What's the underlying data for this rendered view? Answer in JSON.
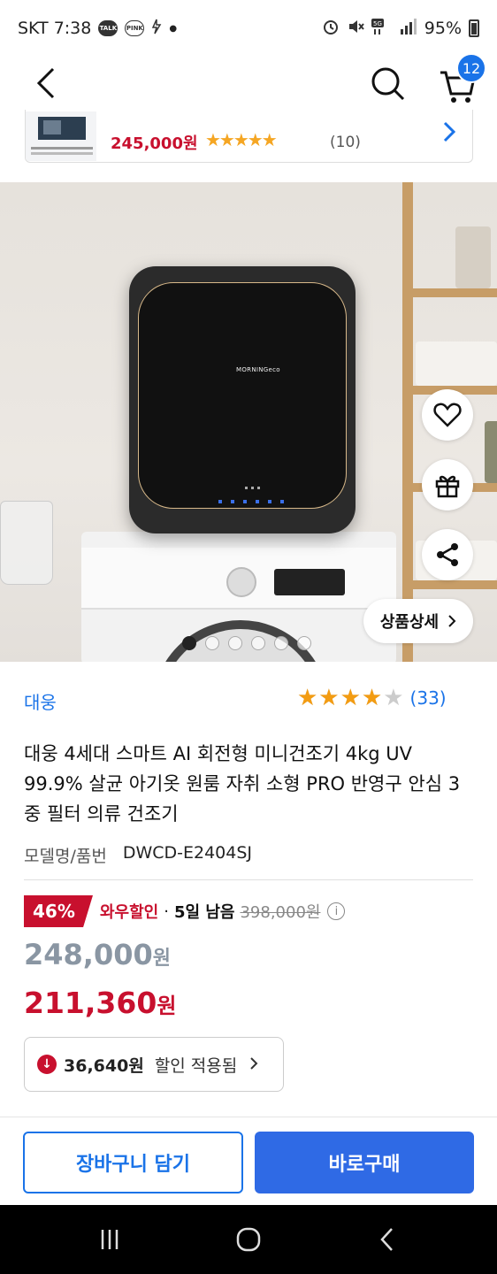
{
  "status_bar": {
    "carrier_time": "SKT 7:38",
    "talk_label": "TALK",
    "pink_label": "PINK",
    "battery": "95%"
  },
  "header": {
    "cart_count": "12"
  },
  "related_product": {
    "price": "245,000원",
    "stars": "★★★★★",
    "review_count": "(10)"
  },
  "product_image": {
    "brand_logo": "MORNINGeco",
    "detail_label": "상품상세",
    "slide_count": 6,
    "active_slide": 1
  },
  "product": {
    "brand": "대웅",
    "rating": 4.0,
    "stars": "★★★★★",
    "review_count": "(33)",
    "title": "대웅 4세대 스마트 AI 회전형 미니건조기 4kg UV 99.9% 살균 아기옷 원룸 자취 소형 PRO 반영구 안심 3중 필터 의류 건조기",
    "model_label": "모델명/품번",
    "model_value": "DWCD-E2404SJ"
  },
  "pricing": {
    "discount_percent": "46%",
    "wow_label": "와우할인",
    "separator": "·",
    "days_left": "5일 남음",
    "original_price": "398,000원",
    "list_price": "248,000",
    "list_price_unit": "원",
    "sale_price": "211,360",
    "sale_price_unit": "원",
    "coupon_amount": "36,640원",
    "coupon_text": "할인 적용됨"
  },
  "actions": {
    "add_to_cart": "장바구니 담기",
    "buy_now": "바로구매"
  },
  "colors": {
    "accent_blue": "#1a73e8",
    "sale_red": "#c8102e",
    "star_orange": "#f39c12"
  }
}
